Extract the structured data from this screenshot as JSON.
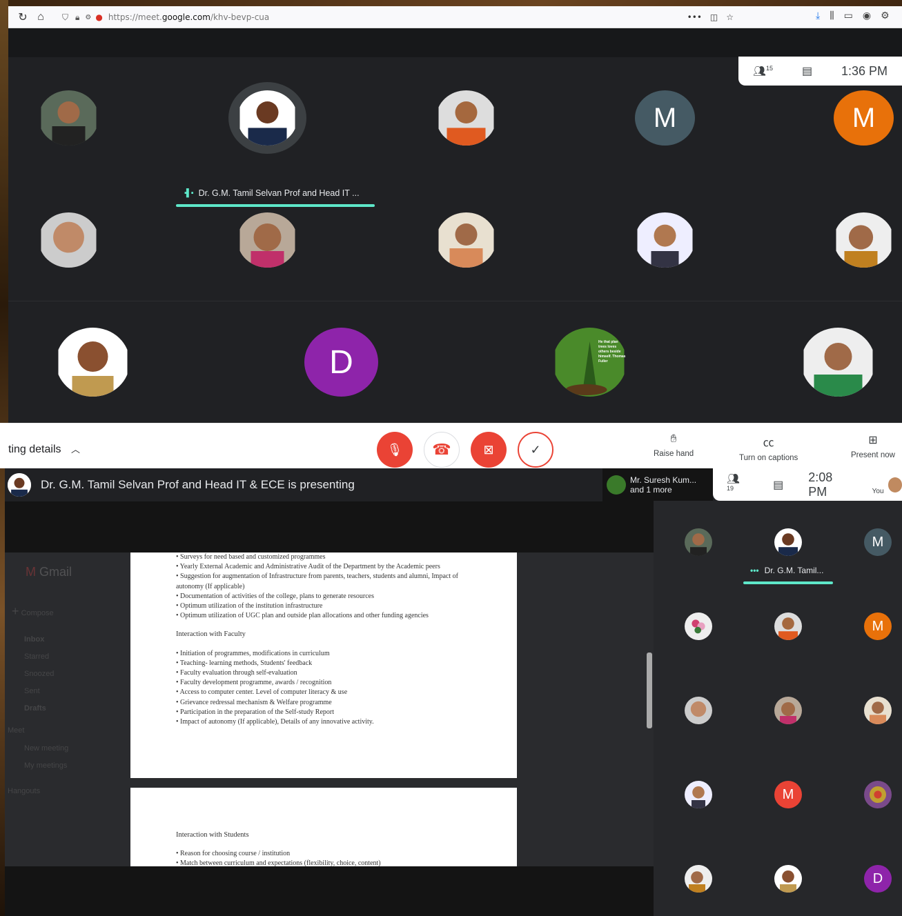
{
  "browser": {
    "url_prefix": "https://meet.",
    "url_domain": "google.com",
    "url_path": "/khv-bevp-cua"
  },
  "meet_top": {
    "participants_count": "15",
    "time": "1:36 PM",
    "speaker_name": "Dr. G.M. Tamil Selvan Prof and Head IT ...",
    "tile_letters": [
      "M",
      "M",
      "D"
    ],
    "thumbnail_caption": "He that plan trees loves others beside himself. Thomas Fuller"
  },
  "controls": {
    "meeting_details": "ting details",
    "raise_hand": "Raise hand",
    "captions": "Turn on captions",
    "present": "Present now"
  },
  "meet_bottom": {
    "presenting_text": "Dr. G.M. Tamil Selvan Prof and Head IT & ECE is presenting",
    "suresh_line1": "Mr. Suresh Kum...",
    "suresh_line2": "and 1 more",
    "participants_count": "19",
    "time": "2:08 PM",
    "you_label": "You",
    "side_speaker": "Dr. G.M. Tamil...",
    "side_letters": [
      "M",
      "M",
      "M",
      "D"
    ]
  },
  "document": {
    "page1_lines": [
      "• Surveys for need based and customized programmes",
      "• Yearly External Academic and Administrative Audit of the Department by the Academic peers",
      "• Suggestion for augmentation of Infrastructure from parents, teachers, students and alumni, Impact of",
      "autonomy (If applicable)",
      "• Documentation of activities of the college, plans to generate resources",
      "• Optimum utilization of the institution infrastructure",
      "• Optimum utilization of UGC plan and outside plan allocations and other funding agencies"
    ],
    "heading_faculty": "Interaction with Faculty",
    "faculty_lines": [
      "• Initiation of programmes, modifications in curriculum",
      "• Teaching- learning methods, Students' feedback",
      "• Faculty evaluation through self-evaluation",
      "• Faculty development programme, awards / recognition",
      "• Access to computer center. Level of computer literacy & use",
      "• Grievance redressal mechanism & Welfare programme",
      "• Participation in the preparation of the Self-study Report",
      "• Impact of autonomy (If applicable), Details of any innovative activity."
    ],
    "heading_students": "Interaction with Students",
    "student_lines": [
      "• Reason for choosing course / institution",
      "• Match between curriculum and expectations (flexibility, choice, content)"
    ]
  },
  "gmail_bg": {
    "brand": "Gmail",
    "compose": "Compose",
    "inbox": "Inbox",
    "starred": "Starred",
    "snoozed": "Snoozed",
    "sent": "Sent",
    "drafts": "Drafts",
    "meet": "Meet",
    "new_meeting": "New meeting",
    "my_meetings": "My meetings",
    "hangouts": "Hangouts"
  },
  "colors": {
    "meet_bg": "#202124",
    "accent": "#5ee7c9",
    "red": "#ea4335",
    "orange": "#e8710a",
    "slate": "#455a64",
    "purple": "#8e24aa"
  }
}
